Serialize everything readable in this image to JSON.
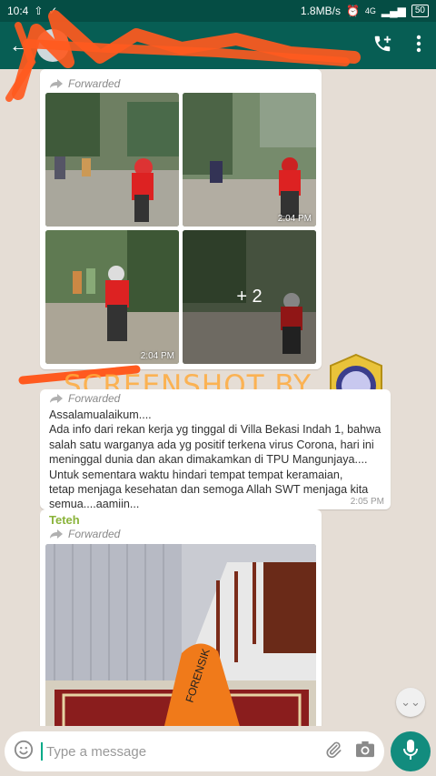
{
  "status_bar": {
    "time": "10:4",
    "net_speed": "1.8MB/s",
    "network": "4G",
    "battery": "50"
  },
  "chat": {
    "title": "",
    "scrolldown_glyph": "⌄⌄"
  },
  "messages": [
    {
      "id": "album",
      "forwarded_label": "Forwarded",
      "photo_times": [
        "2:04 PM",
        "2:04 PM"
      ],
      "more_count": "+ 2"
    },
    {
      "id": "text",
      "forwarded_label": "Forwarded",
      "lines": [
        "Assalamualaikum....",
        "Ada info dari rekan kerja yg tinggal di Villa Bekasi Indah 1, bahwa",
        "salah satu warganya ada yg positif terkena virus Corona, hari ini",
        "meninggal dunia dan akan dimakamkan di TPU Mangunjaya....",
        "Untuk sementara waktu hindari tempat tempat keramaian,",
        "tetap menjaga kesehatan dan semoga Allah SWT menjaga kita",
        "semua....aamiin..."
      ],
      "time": "2:05 PM"
    },
    {
      "id": "photo",
      "sender": "Teteh",
      "forwarded_label": "Forwarded",
      "bag_text": "FORENSIK"
    }
  ],
  "watermark": {
    "text": "SCREENSHOT BY",
    "seal_top": "TURN BACK HOAX",
    "seal_bottom": "MAFINDO",
    "seal_ring": "MASYARAKAT ANTI FITNAH INDONESIA"
  },
  "input": {
    "placeholder": "Type a message"
  },
  "colors": {
    "header": "#075e54",
    "status": "#054d44",
    "accent": "#128c7e",
    "chat_bg": "#e5ddd5",
    "sender": "#8ab33a"
  }
}
